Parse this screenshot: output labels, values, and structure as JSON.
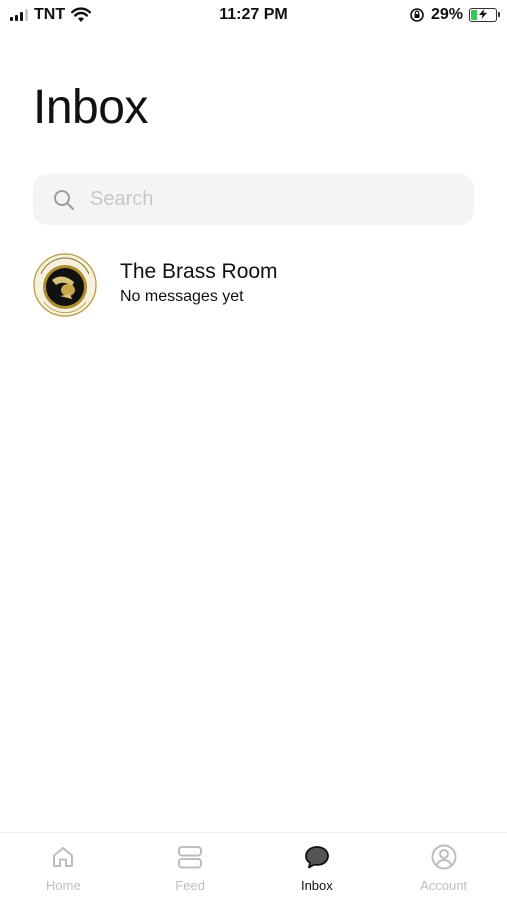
{
  "status_bar": {
    "carrier": "TNT",
    "time": "11:27 PM",
    "battery_percent": "29%",
    "battery_level": 0.29,
    "signal_bars": 3
  },
  "page": {
    "title": "Inbox"
  },
  "search": {
    "placeholder": "Search",
    "value": ""
  },
  "conversations": [
    {
      "name": "The Brass Room",
      "preview": "No messages yet",
      "avatar_icon": "brass-room-logo"
    }
  ],
  "tabbar": {
    "items": [
      {
        "label": "Home",
        "icon": "home-icon",
        "active": false
      },
      {
        "label": "Feed",
        "icon": "feed-icon",
        "active": false
      },
      {
        "label": "Inbox",
        "icon": "chat-bubble-icon",
        "active": true
      },
      {
        "label": "Account",
        "icon": "account-icon",
        "active": false
      }
    ]
  },
  "colors": {
    "accent_active": "#111111",
    "inactive": "#bdbdbd",
    "search_bg": "#f4f4f6",
    "battery_green": "#35c759"
  }
}
